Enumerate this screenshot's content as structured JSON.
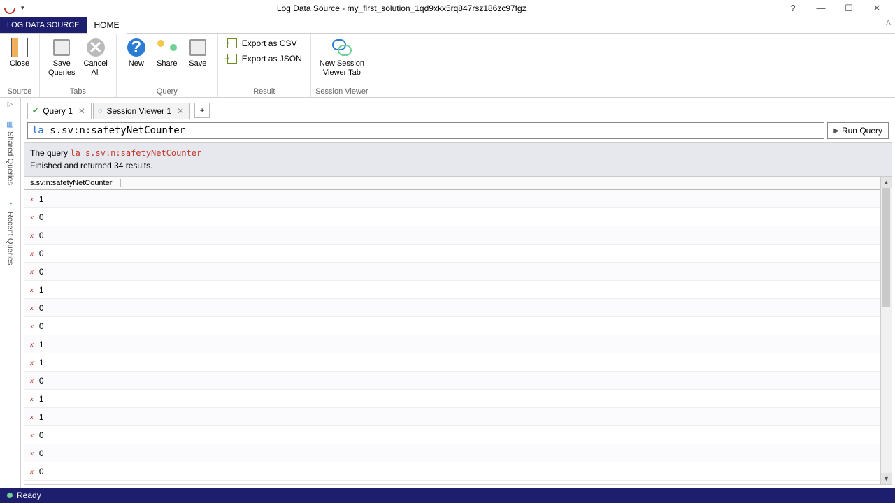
{
  "window": {
    "title": "Log Data Source - my_first_solution_1qd9xkx5rq847rsz186zc97fgz",
    "help": "?"
  },
  "ribbon": {
    "context_tab": "LOG DATA SOURCE",
    "tabs": [
      "HOME"
    ],
    "groups": {
      "source": {
        "name": "Source",
        "close": "Close"
      },
      "tabs_g": {
        "name": "Tabs",
        "save_queries": "Save\nQueries",
        "cancel_all": "Cancel\nAll"
      },
      "query": {
        "name": "Query",
        "new": "New",
        "share": "Share",
        "save": "Save"
      },
      "result": {
        "name": "Result",
        "export_csv": "Export as CSV",
        "export_json": "Export as JSON"
      },
      "session": {
        "name": "Session Viewer",
        "new_sv": "New Session\nViewer Tab"
      }
    }
  },
  "sidebar": {
    "shared": "Shared Queries",
    "recent": "Recent Queries"
  },
  "doctabs": {
    "query1": "Query 1",
    "sv1": "Session Viewer 1"
  },
  "query": {
    "prefix": "la",
    "rest": " s.sv:n:safetyNetCounter",
    "run": "Run Query"
  },
  "banner": {
    "line1_pre": "The query ",
    "line1_code": "la s.sv:n:safetyNetCounter",
    "line2": "Finished and returned 34 results."
  },
  "results": {
    "column": "s.sv:n:safetyNetCounter",
    "values": [
      "1",
      "0",
      "0",
      "0",
      "0",
      "1",
      "0",
      "0",
      "1",
      "1",
      "0",
      "1",
      "1",
      "0",
      "0",
      "0"
    ]
  },
  "status": {
    "text": "Ready"
  }
}
